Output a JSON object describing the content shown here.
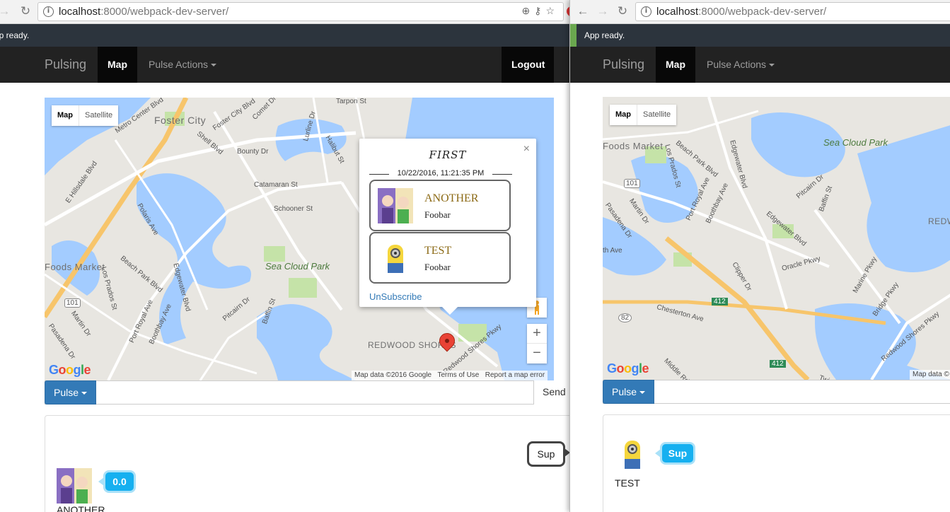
{
  "left_window": {
    "browser": {
      "url_host": "localhost",
      "url_path": ":8000/webpack-dev-server/"
    },
    "status_text": "App ready.",
    "navbar": {
      "brand": "Pulsing",
      "map": "Map",
      "actions": "Pulse Actions",
      "logout": "Logout"
    },
    "map": {
      "type_map": "Map",
      "type_satellite": "Satellite",
      "labels": {
        "foster_city": "Foster City",
        "metro_center": "Metro Center Blvd",
        "shell_blvd": "Shell Blvd",
        "foster_city_blvd": "Foster City Blvd",
        "bounty_dr": "Bounty Dr",
        "comet_dr": "Comet Dr",
        "halibut_st": "Halibut St",
        "tarpon_st": "Tarpon St",
        "lurline_dr": "Lurline Dr",
        "e_hillsdale": "E Hillsdale Blvd",
        "catamaran": "Catamaran St",
        "schooner": "Schooner St",
        "polaris": "Polaris Ave",
        "beach_park": "Beach Park Blvd",
        "foods_market": "Foods Market",
        "los_prados": "Los Prados St",
        "edgewater": "Edgewater Blvd",
        "sea_cloud": "Sea Cloud Park",
        "port_royal": "Port Royal Ave",
        "boothbay": "Boothbay Ave",
        "pitcairn": "Pitcairn Dr",
        "baffin": "Baffin St",
        "pasadena": "Pasadena Dr",
        "martin": "Martin Dr",
        "redwood_shores": "REDWOOD SHORES",
        "redwood_shores_pkwy": "Redwood Shores Pkwy",
        "hwy101": "101"
      },
      "footer": {
        "data": "Map data ©2016 Google",
        "terms": "Terms of Use",
        "report": "Report a map error"
      },
      "google": "Google",
      "zoom_in": "+",
      "zoom_out": "−"
    },
    "info_window": {
      "title": "FIRST",
      "date": "10/22/2016, 11:21:35 PM",
      "cards": [
        {
          "name": "ANOTHER",
          "sub": "Foobar",
          "avatar": "anime-avatar"
        },
        {
          "name": "TEST",
          "sub": "Foobar",
          "avatar": "minion-avatar"
        }
      ],
      "unsubscribe": "UnSubscribe",
      "close": "×"
    },
    "pulse": {
      "button": "Pulse",
      "send": "Send"
    },
    "feed": {
      "bubble_sup": "Sup",
      "user": "ANOTHER",
      "bubble_value": "0.0"
    }
  },
  "right_window": {
    "browser": {
      "url_host": "localhost",
      "url_path": ":8000/webpack-dev-server/"
    },
    "status_text": "App ready.",
    "navbar": {
      "brand": "Pulsing",
      "map": "Map",
      "actions": "Pulse Actions"
    },
    "map": {
      "type_map": "Map",
      "type_satellite": "Satellite",
      "labels": {
        "foods_market": "Foods Market",
        "sea_cloud": "Sea Cloud Park",
        "beach_park": "Beach Park Blvd",
        "los_prados": "Los Prados St",
        "edgewater": "Edgewater Blvd",
        "port_royal": "Port Royal Ave",
        "boothbay": "Boothbay Ave",
        "pitcairn": "Pitcairn Dr",
        "baffin": "Baffin St",
        "pasadena": "Pasadena Dr",
        "martin": "Martin Dr",
        "clipper": "Clipper Dr",
        "oracle": "Oracle Pkwy",
        "marine": "Marine Pkwy",
        "bridge": "Bridge Pkwy",
        "chesterton": "Chesterton Ave",
        "redwood_shores_pkwy": "Redwood Shores Pkwy",
        "middle": "Middle Rd",
        "twin": "Twin D",
        "redwood": "REDWO SHO",
        "th_ave": "th Ave",
        "hwy101": "101",
        "hwy82": "82",
        "hwy412": "412",
        "r_412b": "412"
      },
      "footer": {
        "data": "Map data ©"
      },
      "google": "Google"
    },
    "pulse": {
      "button": "Pulse"
    },
    "feed": {
      "user": "TEST",
      "bubble_sup": "Sup"
    }
  },
  "colors": {
    "navbar": "#222222",
    "navbar_active": "#080808",
    "status_bar": "#2c343d",
    "primary": "#337ab7",
    "bubble_blue": "#16b0f0",
    "water": "#a3ccff",
    "park": "#c5e3a8",
    "highway": "#f7c56b"
  }
}
